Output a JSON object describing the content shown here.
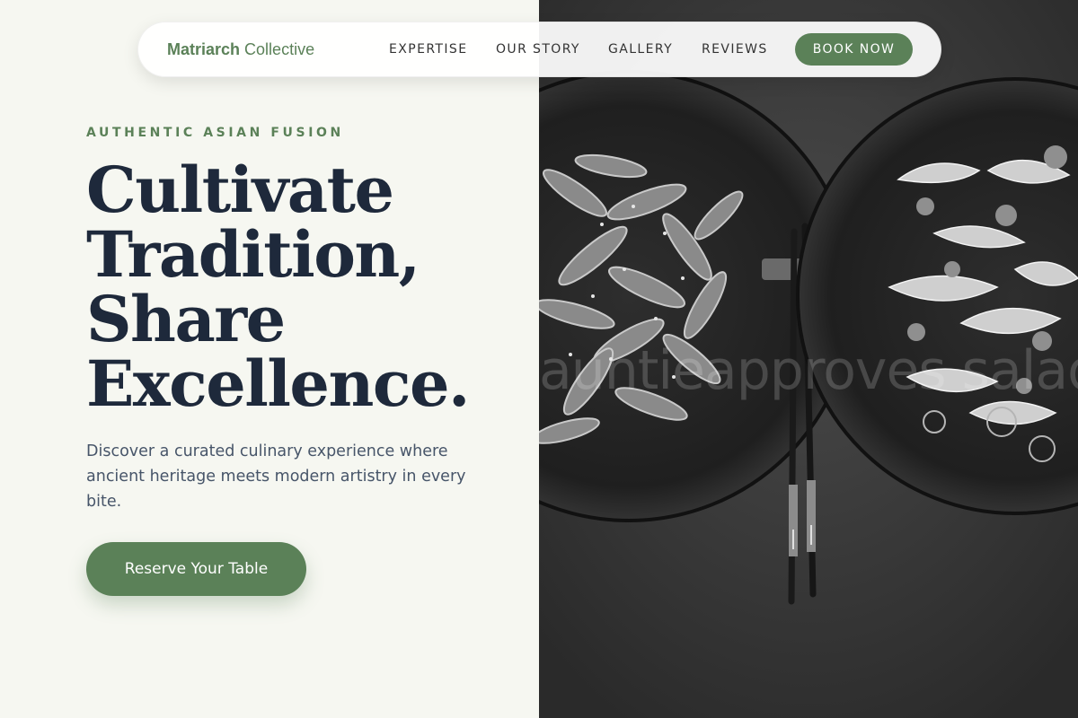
{
  "nav": {
    "brand_strong": "Matriarch",
    "brand_soft": "Collective",
    "links": [
      "EXPERTISE",
      "OUR STORY",
      "GALLERY",
      "REVIEWS"
    ],
    "cta_label": "BOOK NOW"
  },
  "hero": {
    "eyebrow": "AUTHENTIC ASIAN FUSION",
    "headline_lines": [
      "Cultivate",
      "Tradition,",
      "Share",
      "Excellence."
    ],
    "lede": "Discover a curated culinary experience where ancient heritage meets modern artistry in every bite.",
    "cta_label": "Reserve Your Table"
  },
  "image": {
    "watermark_text": "auntieapproves salad"
  },
  "colors": {
    "accent": "#5b8158",
    "heading": "#1e293b",
    "body_text": "#475569",
    "page_bg": "#f6f7f1",
    "photo_bg": "#3a3a3a"
  }
}
